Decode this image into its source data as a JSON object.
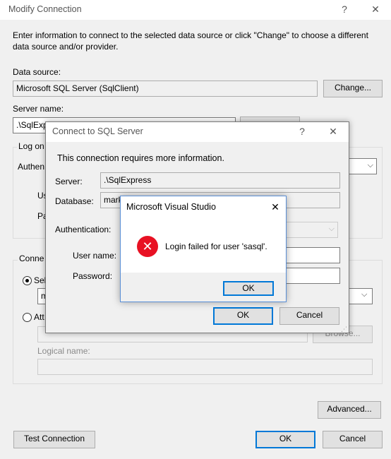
{
  "modify": {
    "title": "Modify Connection",
    "help": "?",
    "close": "✕",
    "intro": "Enter information to connect to the selected data source or click \"Change\" to choose a different data source and/or provider.",
    "data_source_label": "Data source:",
    "data_source_value": "Microsoft SQL Server (SqlClient)",
    "change_label": "Change...",
    "server_name_label": "Server name:",
    "server_name_value": ".\\SqlExpr",
    "log_on_partial": "Log on",
    "authen_partial": "Authen",
    "user_partial": "Us",
    "pass_partial": "Pa",
    "connect_partial": "Conne",
    "select_partial": "Sel",
    "db_partial": "m",
    "attach_partial": "Att",
    "browse_label": "Browse...",
    "logical_name_label": "Logical name:",
    "advanced_label": "Advanced...",
    "test_label": "Test Connection",
    "ok_label": "OK",
    "cancel_label": "Cancel"
  },
  "sql": {
    "title": "Connect to SQL Server",
    "help": "?",
    "close": "✕",
    "message": "This connection requires more information.",
    "server_label": "Server:",
    "server_value": ".\\SqlExpress",
    "database_label": "Database:",
    "database_value": "mark",
    "auth_label": "Authentication:",
    "username_label": "User name:",
    "password_label": "Password:",
    "ok_label": "OK",
    "cancel_label": "Cancel"
  },
  "msgbox": {
    "title": "Microsoft Visual Studio",
    "close": "✕",
    "message": "Login failed for user 'sasql'.",
    "ok_label": "OK"
  },
  "colors": {
    "accent": "#0078d7",
    "error": "#e81123"
  }
}
